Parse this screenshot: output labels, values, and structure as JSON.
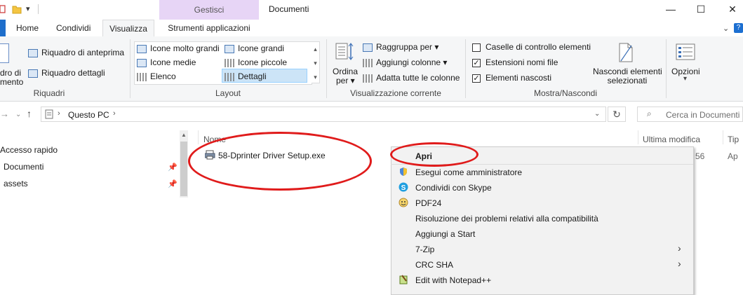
{
  "window": {
    "context_tab_group": "Gestisci",
    "title": "Documenti",
    "minimize": "—",
    "maximize": "☐",
    "close": "✕"
  },
  "tabs": {
    "home": "Home",
    "condividi": "Condividi",
    "visualizza": "Visualizza",
    "strumenti": "Strumenti applicazioni",
    "help": "?"
  },
  "ribbon": {
    "riquadri": {
      "nav_pane_label_1": "dro di",
      "nav_pane_label_2": "mento",
      "anteprima": "Riquadro di anteprima",
      "dettagli": "Riquadro dettagli",
      "group": "Riquadri"
    },
    "layout": {
      "molto_grandi": "Icone molto grandi",
      "grandi": "Icone grandi",
      "medie": "Icone medie",
      "piccole": "Icone piccole",
      "elenco": "Elenco",
      "dettagli": "Dettagli",
      "group": "Layout"
    },
    "visualizzazione": {
      "ordina_1": "Ordina",
      "ordina_2": "per",
      "raggruppa": "Raggruppa per",
      "aggiungi": "Aggiungi colonne",
      "adatta": "Adatta tutte le colonne",
      "group": "Visualizzazione corrente"
    },
    "mostra": {
      "caselle": "Caselle di controllo elementi",
      "estensioni": "Estensioni nomi file",
      "nascosti": "Elementi nascosti",
      "nascondi_1": "Nascondi elementi",
      "nascondi_2": "selezionati",
      "group": "Mostra/Nascondi",
      "caselle_checked": false,
      "estensioni_checked": true,
      "nascosti_checked": true
    },
    "opzioni": {
      "label": "Opzioni"
    }
  },
  "address": {
    "path": "Questo PC",
    "search_placeholder": "Cerca in Documenti"
  },
  "nav": {
    "accesso_rapido": "Accesso rapido",
    "documenti": "Documenti",
    "assets": "assets"
  },
  "columns": {
    "nome": "Nome",
    "ultima_modifica": "Ultima modifica",
    "tipo": "Tip",
    "partial_date": "56",
    "partial_type": "Ap"
  },
  "files": [
    {
      "name": "58-Dprinter Driver Setup.exe"
    }
  ],
  "context_menu": {
    "items": [
      {
        "label": "Apri",
        "bold": true
      },
      {
        "label": "Esegui come amministratore"
      },
      {
        "label": "Condividi con Skype"
      },
      {
        "label": "PDF24"
      },
      {
        "label": "Risoluzione dei problemi relativi alla compatibilità"
      },
      {
        "label": "Aggiungi a Start"
      },
      {
        "label": "7-Zip",
        "submenu": true
      },
      {
        "label": "CRC SHA",
        "submenu": true
      },
      {
        "label": "Edit with Notepad++"
      }
    ]
  },
  "colors": {
    "accent": "#0063b1",
    "context_tab": "#e7d5f6",
    "annotation": "#e01b1b",
    "selection": "#cce4f7"
  }
}
